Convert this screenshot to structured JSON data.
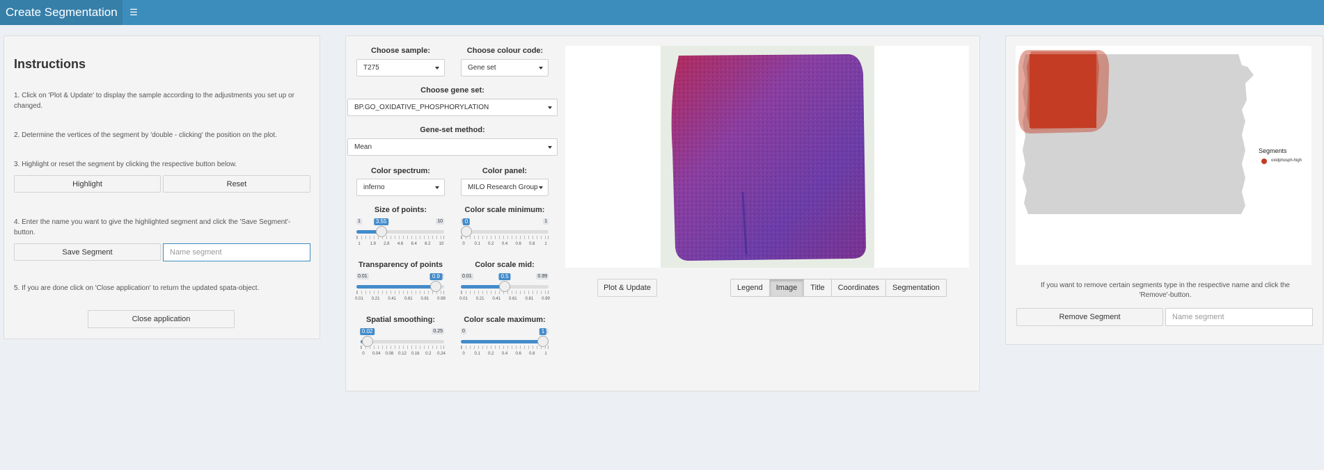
{
  "header": {
    "title": "Create Segmentation",
    "menu_icon": "hamburger-icon"
  },
  "instructions": {
    "title": "Instructions",
    "step1": "1. Click on 'Plot & Update' to display the sample according to the adjustments you set up or changed.",
    "step2": "2. Determine the vertices of the segment by 'double - clicking' the position on the plot.",
    "step3": "3. Highlight or reset the segment by clicking the respective button below.",
    "highlight_label": "Highlight",
    "reset_label": "Reset",
    "step4": "4. Enter the name you want to give the highlighted segment and click the 'Save Segment'-button.",
    "save_label": "Save Segment",
    "name_placeholder": "Name segment",
    "step5": "5. If you are done click on 'Close application' to return the updated spata-object.",
    "close_label": "Close application"
  },
  "controls": {
    "sample": {
      "label": "Choose sample:",
      "value": "T275"
    },
    "colour_code": {
      "label": "Choose colour code:",
      "value": "Gene set"
    },
    "gene_set": {
      "label": "Choose gene set:",
      "value": "BP.GO_OXIDATIVE_PHOSPHORYLATION"
    },
    "method": {
      "label": "Gene-set method:",
      "value": "Mean"
    },
    "spectrum": {
      "label": "Color spectrum:",
      "value": "inferno"
    },
    "panel": {
      "label": "Color panel:",
      "value": "MILO Research Group"
    },
    "point_size": {
      "label": "Size of points:",
      "min": "1",
      "max": "10",
      "value": "3.55",
      "fraction": 0.283,
      "grid": [
        "1",
        "1.9",
        "2.8",
        "4.6",
        "6.4",
        "8.2",
        "10"
      ]
    },
    "transparency": {
      "label": "Transparency of points",
      "min": "0.01",
      "max": "0.99",
      "value": "0.9",
      "fraction": 0.908,
      "grid": [
        "0.01",
        "0.21",
        "0.41",
        "0.61",
        "0.81",
        "0.99"
      ]
    },
    "smoothing": {
      "label": "Spatial smoothing:",
      "min": "0",
      "max": "0.25",
      "value": "0.02",
      "fraction": 0.08,
      "grid": [
        "0",
        "0.04",
        "0.08",
        "0.12",
        "0.16",
        "0.2",
        "0.24"
      ]
    },
    "scale_min": {
      "label": "Color scale minimum:",
      "min": "0",
      "max": "1",
      "value": "0",
      "fraction": 0.0,
      "grid": [
        "0",
        "0.1",
        "0.2",
        "0.4",
        "0.6",
        "0.8",
        "1"
      ]
    },
    "scale_mid": {
      "label": "Color scale mid:",
      "min": "0.01",
      "max": "0.99",
      "value": "0.5",
      "fraction": 0.5,
      "grid": [
        "0.01",
        "0.21",
        "0.41",
        "0.61",
        "0.81",
        "0.99"
      ]
    },
    "scale_max": {
      "label": "Color scale maximum:",
      "min": "0",
      "max": "1",
      "value": "1",
      "fraction": 1.0,
      "grid": [
        "0",
        "0.1",
        "0.2",
        "0.4",
        "0.6",
        "0.8",
        "1"
      ]
    },
    "plot_label": "Plot & Update"
  },
  "tabs": [
    "Legend",
    "Image",
    "Title",
    "Coordinates",
    "Segmentation"
  ],
  "active_tab": "Image",
  "segments": {
    "legend_title": "Segments",
    "legend_item": "oxidphosph-high",
    "segment_color": "#c43c24",
    "remove_note": "If you want to remove certain segments type in the respective name and click the 'Remove'-button.",
    "remove_label": "Remove Segment",
    "name_placeholder": "Name segment"
  },
  "colors": {
    "header": "#3c8dbc",
    "brand": "#367fa9",
    "accent": "#428bca"
  }
}
